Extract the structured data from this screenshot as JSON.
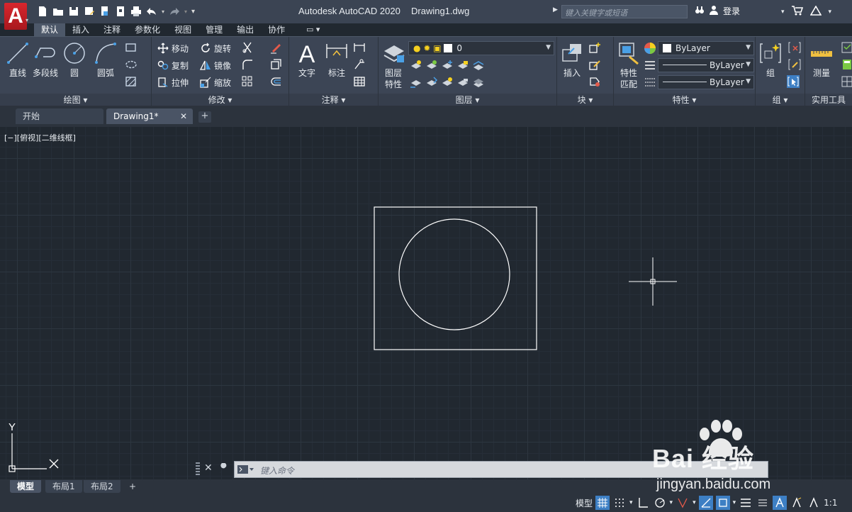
{
  "titlebar": {
    "app_name": "Autodesk AutoCAD 2020",
    "file_name": "Drawing1.dwg",
    "search_placeholder": "键入关键字或短语",
    "login": "登录",
    "app_letter": "A"
  },
  "ribbon_tabs": [
    "默认",
    "插入",
    "注释",
    "参数化",
    "视图",
    "管理",
    "输出",
    "协作"
  ],
  "ribbon": {
    "draw": {
      "title": "绘图 ▾",
      "line": "直线",
      "polyline": "多段线",
      "circle": "圆",
      "arc": "圆弧"
    },
    "modify": {
      "title": "修改 ▾",
      "move": "移动",
      "rotate": "旋转",
      "copy": "复制",
      "mirror": "镜像",
      "stretch": "拉伸",
      "scale": "缩放"
    },
    "annotation": {
      "title": "注释 ▾",
      "text": "文字",
      "dimension": "标注"
    },
    "layers": {
      "title": "图层 ▾",
      "layer_props": "图层\n特性",
      "layer_props_1": "图层",
      "layer_props_2": "特性",
      "current_layer": "0"
    },
    "block": {
      "title": "块 ▾",
      "insert": "插入"
    },
    "properties": {
      "title": "特性 ▾",
      "match_1": "特性",
      "match_2": "匹配",
      "color": "ByLayer",
      "linetype": "ByLayer",
      "lineweight": "ByLayer"
    },
    "group": {
      "title": "组 ▾",
      "group": "组"
    },
    "utilities": {
      "title": "实用工具",
      "measure": "测量"
    }
  },
  "file_tabs": {
    "start": "开始",
    "drawing": "Drawing1*",
    "close": "✕",
    "add": "+"
  },
  "canvas": {
    "viewport_label": "[−][俯视][二维线框]",
    "ucs_y": "Y",
    "ucs_x": "X",
    "command_placeholder": "键入命令"
  },
  "layout_tabs": [
    "模型",
    "布局1",
    "布局2"
  ],
  "layout_add": "+",
  "status": {
    "model": "模型",
    "scale": "1:1"
  },
  "watermark": {
    "text": "Bai  经验",
    "url": "jingyan.baidu.com"
  }
}
